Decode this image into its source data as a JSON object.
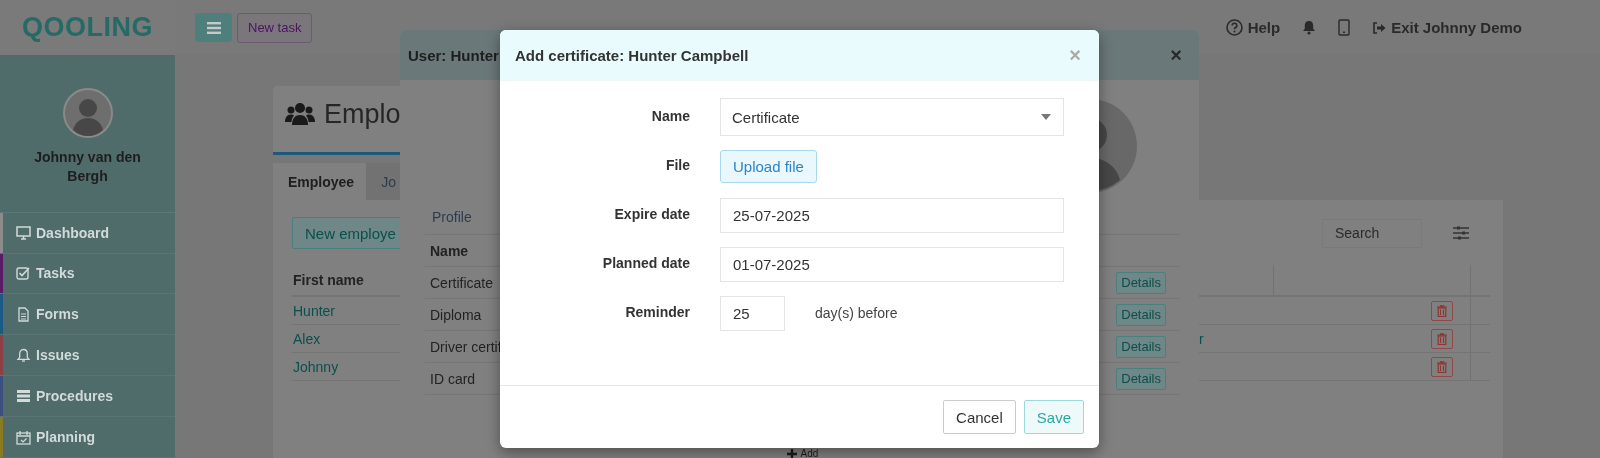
{
  "header": {
    "logo": "QOOLING",
    "new_task": "New task",
    "help": "Help",
    "exit": "Exit Johnny Demo"
  },
  "sidebar": {
    "user": "Johnny van den Bergh",
    "items": [
      {
        "kind": "dashboard",
        "label": "Dashboard",
        "color": "#8c8c8c"
      },
      {
        "kind": "tasks",
        "label": "Tasks",
        "color": "#5a1a68"
      },
      {
        "kind": "forms",
        "label": "Forms",
        "color": "#1b5a85"
      },
      {
        "kind": "issues",
        "label": "Issues",
        "color": "#8c4046"
      },
      {
        "kind": "procedures",
        "label": "Procedures",
        "color": "#3c4f80"
      },
      {
        "kind": "planning",
        "label": "Planning",
        "color": "#8a7a20"
      }
    ]
  },
  "page": {
    "title": "Emplo",
    "tabs": [
      {
        "label": "Employee",
        "selected": true
      },
      {
        "label": "Jo",
        "selected": false
      }
    ],
    "new_button": "New employe",
    "search": {
      "placeholder": "Search"
    },
    "table": {
      "columns": [
        "First name"
      ],
      "rows": [
        {
          "first_name": "Hunter"
        },
        {
          "first_name": "Alex",
          "column_2": "r"
        },
        {
          "first_name": "Johnny"
        }
      ]
    }
  },
  "user_dialog": {
    "title": "User: Hunter",
    "close": "×",
    "tab": "Profile",
    "table": {
      "columns": [
        "Name"
      ],
      "rows": [
        {
          "name": "Certificate",
          "action": "Details"
        },
        {
          "name": "Diploma",
          "action": "Details"
        },
        {
          "name": "Driver certif",
          "action": "Details"
        },
        {
          "name": "ID card",
          "action": "Details"
        }
      ]
    },
    "add": "Add"
  },
  "dialog": {
    "title": "Add certificate: Hunter Campbell",
    "close": "×",
    "fields": [
      {
        "kind": "select",
        "label": "Name",
        "value": "Certificate"
      },
      {
        "kind": "upload",
        "label": "File",
        "button": "Upload file"
      },
      {
        "kind": "text",
        "label": "Expire date",
        "value": "25-07-2025"
      },
      {
        "kind": "text",
        "label": "Planned date",
        "value": "01-07-2025"
      },
      {
        "kind": "number",
        "label": "Reminder",
        "value": "25",
        "suffix": "day(s) before"
      }
    ],
    "buttons": [
      {
        "kind": "default",
        "label": "Cancel"
      },
      {
        "kind": "primary",
        "label": "Save"
      }
    ]
  }
}
